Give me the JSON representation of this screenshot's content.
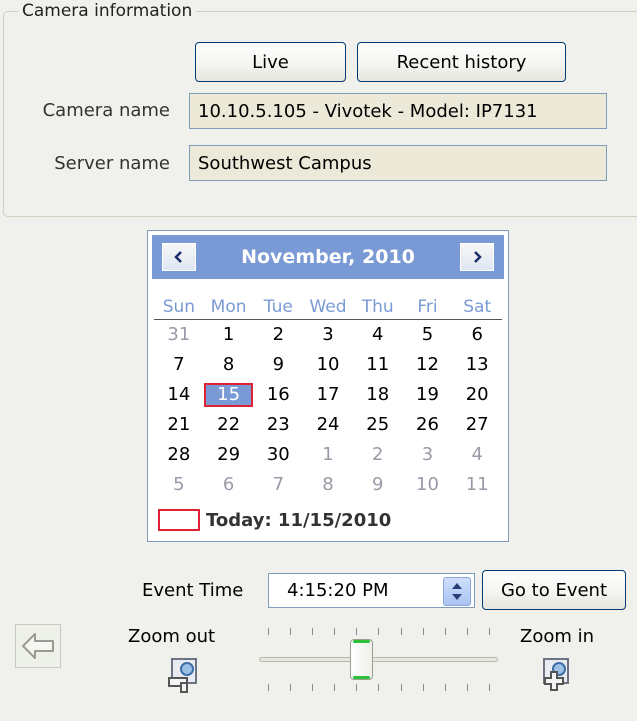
{
  "camera_info": {
    "group_title": "Camera information",
    "live_label": "Live",
    "recent_history_label": "Recent history",
    "camera_name_label": "Camera name",
    "camera_name_value": "10.10.5.105 - Vivotek - Model: IP7131",
    "server_name_label": "Server name",
    "server_name_value": "Southwest Campus"
  },
  "calendar": {
    "month_title": "November, 2010",
    "days_of_week": [
      "Sun",
      "Mon",
      "Tue",
      "Wed",
      "Thu",
      "Fri",
      "Sat"
    ],
    "weeks": [
      [
        "31",
        "1",
        "2",
        "3",
        "4",
        "5",
        "6"
      ],
      [
        "7",
        "8",
        "9",
        "10",
        "11",
        "12",
        "13"
      ],
      [
        "14",
        "15",
        "16",
        "17",
        "18",
        "19",
        "20"
      ],
      [
        "21",
        "22",
        "23",
        "24",
        "25",
        "26",
        "27"
      ],
      [
        "28",
        "29",
        "30",
        "1",
        "2",
        "3",
        "4"
      ],
      [
        "5",
        "6",
        "7",
        "8",
        "9",
        "10",
        "11"
      ]
    ],
    "selected_day": "15",
    "today_label": "Today: 11/15/2010"
  },
  "event": {
    "event_time_label": "Event Time",
    "event_time_value": "4:15:20 PM",
    "go_to_event_label": "Go to Event"
  },
  "zoom": {
    "zoom_out_label": "Zoom out",
    "zoom_in_label": "Zoom in",
    "slider_fraction": 0.42
  },
  "icons": [
    "back-arrow-icon",
    "zoom-out-icon",
    "zoom-in-icon",
    "chevron-left-icon",
    "chevron-right-icon",
    "spin-up-icon",
    "spin-down-icon"
  ],
  "colors": {
    "calendar_accent": "#7a9ad5",
    "today_marker": "#dd2233",
    "button_border": "#003c74"
  }
}
